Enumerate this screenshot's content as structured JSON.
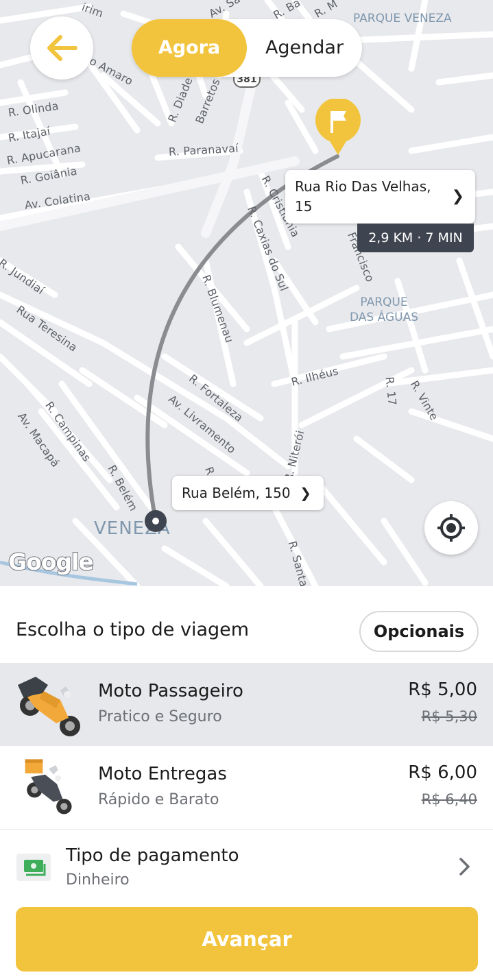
{
  "map": {
    "streets": [
      "irim",
      "Av. Sa",
      "R. Ba",
      "R. M",
      "o Amaro",
      "R. Diade",
      "Barretos",
      "R. Olinda",
      "R. Itajaí",
      "R. Apucarana",
      "R. Goiânia",
      "Av. Colatina",
      "R. Paranavaí",
      "R. Cristiania",
      "R. Caxias do Sul",
      "Francisco",
      "R. Jundiaí",
      "Rua Teresina",
      "R. Blumenau",
      "R. Ilhéus",
      "R. 17",
      "R. Vinte",
      "R. Fortaleza",
      "Av. Livramento",
      "R. Campinas",
      "Av. Macapá",
      "R. Belém",
      "R. Niterói",
      "R. Santaré",
      "R."
    ],
    "areas": [
      "PARQUE VENEZA",
      "PARQUE DAS ÁGUAS"
    ],
    "neighborhood": "VENEZA",
    "highway_shield": "381",
    "google_logo": "Google"
  },
  "toggle": {
    "now": "Agora",
    "schedule": "Agendar",
    "selected": "now"
  },
  "destination": {
    "address": "Rua Rio Das Velhas, 15",
    "route_info": "2,9 KM · 7 MIN"
  },
  "origin": {
    "address": "Rua Belém, 150"
  },
  "sheet": {
    "title": "Escolha o tipo de viagem",
    "optionals_label": "Opcionais",
    "rides": [
      {
        "name": "Moto Passageiro",
        "subtitle": "Pratico e Seguro",
        "price": "R$ 5,00",
        "old_price": "R$ 5,30",
        "icon": "motorcycle-icon"
      },
      {
        "name": "Moto Entregas",
        "subtitle": "Rápido e Barato",
        "price": "R$ 6,00",
        "old_price": "R$ 6,40",
        "icon": "delivery-motorcycle-icon"
      }
    ],
    "payment": {
      "title": "Tipo de pagamento",
      "value": "Dinheiro",
      "icon": "cash-icon"
    },
    "advance_label": "Avançar"
  },
  "colors": {
    "accent": "#f2c43e",
    "dark": "#3f4550",
    "selected_row": "#e6e8ec"
  }
}
